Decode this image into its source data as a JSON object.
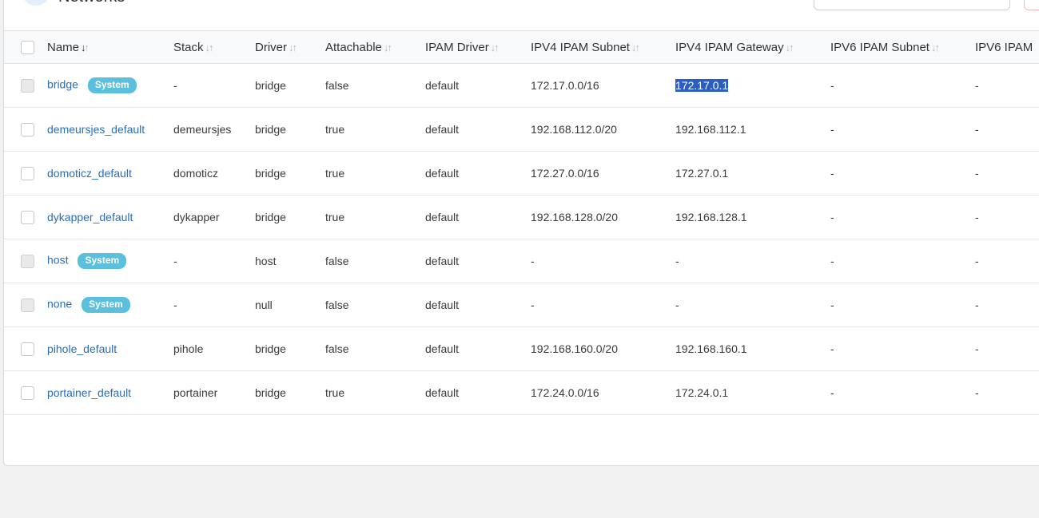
{
  "header": {
    "title": "Networks"
  },
  "columns": [
    {
      "label": "Name"
    },
    {
      "label": "Stack"
    },
    {
      "label": "Driver"
    },
    {
      "label": "Attachable"
    },
    {
      "label": "IPAM Driver"
    },
    {
      "label": "IPV4 IPAM Subnet"
    },
    {
      "label": "IPV4 IPAM Gateway"
    },
    {
      "label": "IPV6 IPAM Subnet"
    },
    {
      "label": "IPV6 IPAM"
    }
  ],
  "rows": [
    {
      "name": "bridge",
      "badge": "System",
      "stack": "-",
      "driver": "bridge",
      "attachable": "false",
      "ipam_driver": "default",
      "ipv4_subnet": "172.17.0.0/16",
      "ipv4_gateway": "172.17.0.1",
      "ipv6_subnet": "-",
      "ipv6_gateway": "-"
    },
    {
      "name": "demeursjes_default",
      "badge": "",
      "stack": "demeursjes",
      "driver": "bridge",
      "attachable": "true",
      "ipam_driver": "default",
      "ipv4_subnet": "192.168.112.0/20",
      "ipv4_gateway": "192.168.112.1",
      "ipv6_subnet": "-",
      "ipv6_gateway": "-"
    },
    {
      "name": "domoticz_default",
      "badge": "",
      "stack": "domoticz",
      "driver": "bridge",
      "attachable": "true",
      "ipam_driver": "default",
      "ipv4_subnet": "172.27.0.0/16",
      "ipv4_gateway": "172.27.0.1",
      "ipv6_subnet": "-",
      "ipv6_gateway": "-"
    },
    {
      "name": "dykapper_default",
      "badge": "",
      "stack": "dykapper",
      "driver": "bridge",
      "attachable": "true",
      "ipam_driver": "default",
      "ipv4_subnet": "192.168.128.0/20",
      "ipv4_gateway": "192.168.128.1",
      "ipv6_subnet": "-",
      "ipv6_gateway": "-"
    },
    {
      "name": "host",
      "badge": "System",
      "stack": "-",
      "driver": "host",
      "attachable": "false",
      "ipam_driver": "default",
      "ipv4_subnet": "-",
      "ipv4_gateway": "-",
      "ipv6_subnet": "-",
      "ipv6_gateway": "-"
    },
    {
      "name": "none",
      "badge": "System",
      "stack": "-",
      "driver": "null",
      "attachable": "false",
      "ipam_driver": "default",
      "ipv4_subnet": "-",
      "ipv4_gateway": "-",
      "ipv6_subnet": "-",
      "ipv6_gateway": "-"
    },
    {
      "name": "pihole_default",
      "badge": "",
      "stack": "pihole",
      "driver": "bridge",
      "attachable": "false",
      "ipam_driver": "default",
      "ipv4_subnet": "192.168.160.0/20",
      "ipv4_gateway": "192.168.160.1",
      "ipv6_subnet": "-",
      "ipv6_gateway": "-"
    },
    {
      "name": "portainer_default",
      "badge": "",
      "stack": "portainer",
      "driver": "bridge",
      "attachable": "true",
      "ipam_driver": "default",
      "ipv4_subnet": "172.24.0.0/16",
      "ipv4_gateway": "172.24.0.1",
      "ipv6_subnet": "-",
      "ipv6_gateway": "-"
    }
  ],
  "selection": {
    "highlighted_text": "172.17.0.1"
  },
  "colors": {
    "link": "#2a6db8",
    "badge": "#5bc0de",
    "selection": "#2a5ec4"
  },
  "icons": {
    "sort": "sort-arrows-icon",
    "network": "network-icon",
    "search": "search-icon"
  }
}
